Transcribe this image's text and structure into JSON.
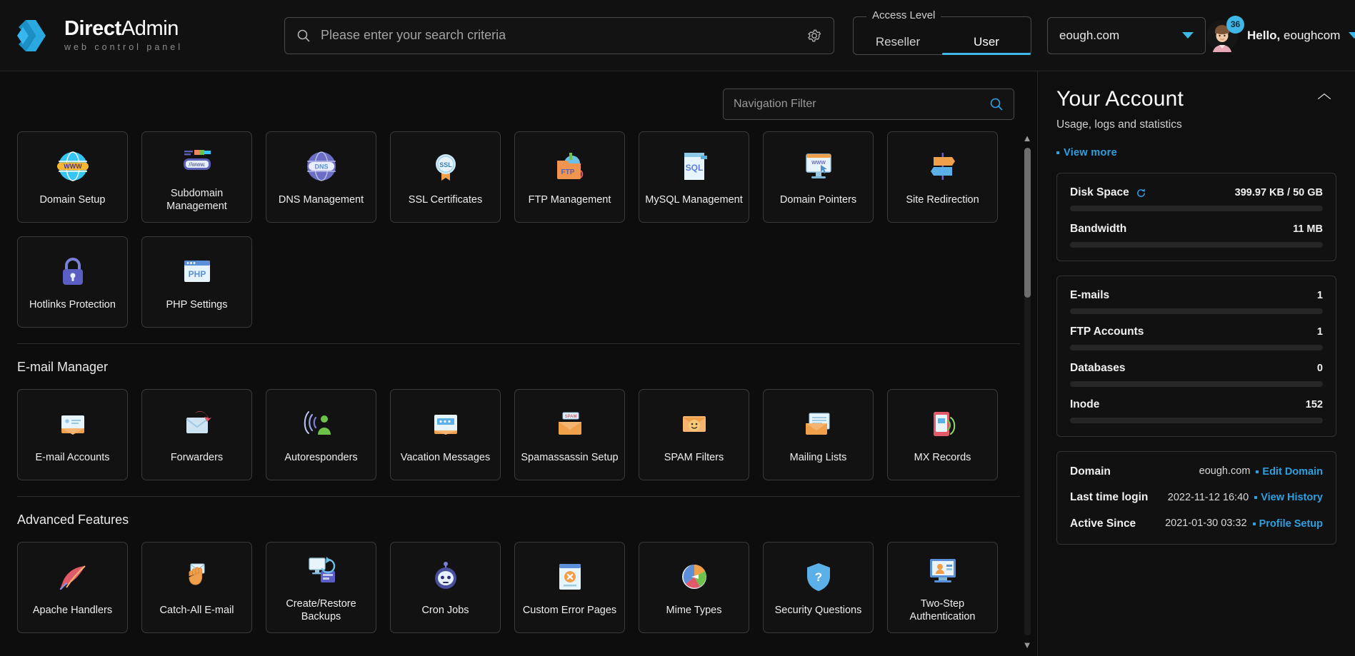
{
  "header": {
    "logo_title_bold": "Direct",
    "logo_title_light": "Admin",
    "logo_subtitle": "web control panel",
    "search_placeholder": "Please enter your search criteria",
    "search_value": "",
    "search_icon": "search-icon",
    "settings_icon": "gear-icon",
    "access_level_legend": "Access Level",
    "access_tabs": [
      {
        "label": "Reseller",
        "active": false
      },
      {
        "label": "User",
        "active": true
      }
    ],
    "domain_selected": "eough.com",
    "domain_caret_icon": "chevron-down-icon",
    "avatar_badge": "36",
    "greeting_bold": "Hello,",
    "greeting_user": "eoughcom",
    "user_caret_icon": "chevron-down-icon",
    "accent_color": "#3fb8e8"
  },
  "main": {
    "nav_filter_placeholder": "Navigation Filter",
    "nav_filter_value": "",
    "nav_filter_icon": "search-icon",
    "scroll_up_icon": "chevron-up-icon",
    "scroll_down_icon": "chevron-down-icon",
    "sections": [
      {
        "title": "",
        "tiles": [
          {
            "label": "Domain Setup",
            "icon": "globe-www-icon"
          },
          {
            "label": "Subdomain Management",
            "icon": "subdomain-bar-icon"
          },
          {
            "label": "DNS Management",
            "icon": "globe-dns-icon"
          },
          {
            "label": "SSL Certificates",
            "icon": "ssl-badge-icon"
          },
          {
            "label": "FTP Management",
            "icon": "ftp-folder-icon"
          },
          {
            "label": "MySQL Management",
            "icon": "sql-document-icon"
          },
          {
            "label": "Domain Pointers",
            "icon": "monitor-www-icon"
          },
          {
            "label": "Site Redirection",
            "icon": "signpost-icon"
          },
          {
            "label": "Hotlinks Protection",
            "icon": "padlock-icon"
          },
          {
            "label": "PHP Settings",
            "icon": "php-window-icon"
          }
        ]
      },
      {
        "title": "E-mail Manager",
        "tiles": [
          {
            "label": "E-mail Accounts",
            "icon": "envelope-accounts-icon"
          },
          {
            "label": "Forwarders",
            "icon": "forward-arrow-icon"
          },
          {
            "label": "Autoresponders",
            "icon": "autoresponder-person-icon"
          },
          {
            "label": "Vacation Messages",
            "icon": "vacation-envelope-icon"
          },
          {
            "label": "Spamassassin Setup",
            "icon": "spam-envelope-icon"
          },
          {
            "label": "SPAM Filters",
            "icon": "spam-filter-icon"
          },
          {
            "label": "Mailing Lists",
            "icon": "mailing-list-icon"
          },
          {
            "label": "MX Records",
            "icon": "mx-records-icon"
          }
        ]
      },
      {
        "title": "Advanced Features",
        "tiles": [
          {
            "label": "Apache Handlers",
            "icon": "feather-icon"
          },
          {
            "label": "Catch-All E-mail",
            "icon": "catch-hand-icon"
          },
          {
            "label": "Create/Restore Backups",
            "icon": "backup-restore-icon"
          },
          {
            "label": "Cron Jobs",
            "icon": "robot-icon"
          },
          {
            "label": "Custom Error Pages",
            "icon": "error-page-icon"
          },
          {
            "label": "Mime Types",
            "icon": "mime-types-icon"
          },
          {
            "label": "Security Questions",
            "icon": "security-question-icon"
          },
          {
            "label": "Two-Step Authentication",
            "icon": "two-step-auth-icon"
          }
        ]
      }
    ]
  },
  "account_panel": {
    "title": "Your Account",
    "subtitle": "Usage, logs and statistics",
    "collapse_icon": "chevron-up-icon",
    "view_more": "View more",
    "usage_stats": [
      {
        "name": "Disk Space",
        "value": "399.97 KB / 50 GB",
        "percent": 0,
        "refresh_icon": "refresh-icon"
      },
      {
        "name": "Bandwidth",
        "value": "11 MB",
        "percent": 0
      }
    ],
    "count_stats": [
      {
        "name": "E-mails",
        "value": "1",
        "percent": 0
      },
      {
        "name": "FTP Accounts",
        "value": "1",
        "percent": 0
      },
      {
        "name": "Databases",
        "value": "0",
        "percent": 0
      },
      {
        "name": "Inode",
        "value": "152",
        "percent": 0
      }
    ],
    "info_rows": [
      {
        "label": "Domain",
        "value": "eough.com",
        "link": "Edit Domain"
      },
      {
        "label": "Last time login",
        "value": "2022-11-12 16:40",
        "link": "View History"
      },
      {
        "label": "Active Since",
        "value": "2021-01-30 03:32",
        "link": "Profile Setup"
      }
    ],
    "link_color": "#2f9fe0"
  }
}
